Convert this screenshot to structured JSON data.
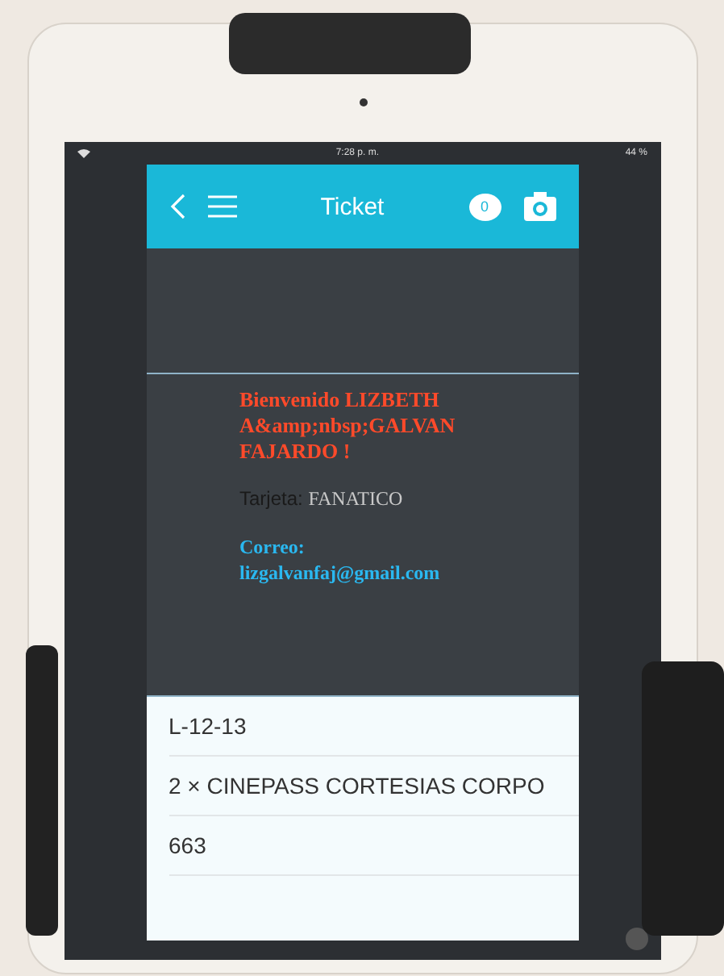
{
  "status_bar": {
    "time": "7:28 p. m.",
    "battery": "44 %"
  },
  "header": {
    "title": "Ticket",
    "badge": "0"
  },
  "welcome": "Bienvenido LIZBETH A&amp;nbsp;GALVAN FAJARDO !",
  "card": {
    "label": "Tarjeta:",
    "value": "FANATICO"
  },
  "email": {
    "label": "Correo:",
    "value": "lizgalvanfaj@gmail.com"
  },
  "items": [
    "L-12-13",
    "2 × CINEPASS CORTESIAS CORPO",
    "663"
  ]
}
